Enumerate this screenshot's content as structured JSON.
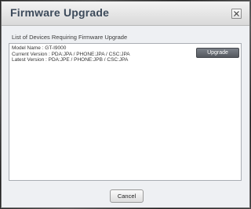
{
  "window": {
    "title": "Firmware Upgrade",
    "close_icon": "close-icon"
  },
  "main": {
    "section_label": "List of Devices Requiring Firmware Upgrade",
    "device": {
      "model_name": "Model Name : GT-I9000",
      "current_version": "Current Version : PDA:JPA / PHONE:JPA / CSC:JPA",
      "latest_version": "Latest Version : PDA:JPE / PHONE:JPB / CSC:JPA",
      "upgrade_label": "Upgrade"
    }
  },
  "footer": {
    "cancel_label": "Cancel"
  },
  "colors": {
    "title_text": "#3c4a5a",
    "upgrade_button": "#5e6268",
    "panel_background": "#eef0f3"
  }
}
